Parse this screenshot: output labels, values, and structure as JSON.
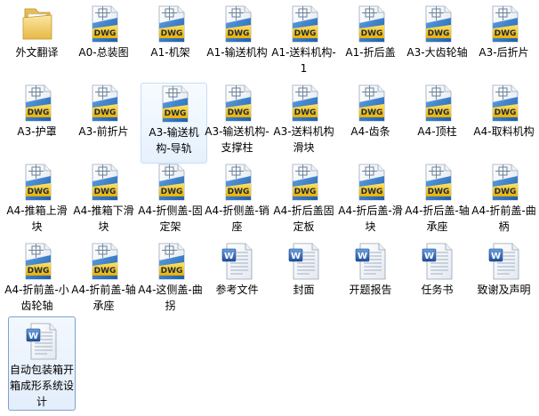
{
  "window": {
    "title": "自动包装箱开箱成形系统设计"
  },
  "icons": {
    "folder": "folder-icon",
    "dwg": "dwg-file-icon",
    "word": "word-document-icon"
  },
  "colors": {
    "selection_border": "#7da2ce",
    "selection_fill": "#e3eefc",
    "dwg_yellow": "#f2c200",
    "dwg_blue": "#2e76c6"
  },
  "files": [
    {
      "name": "外文翻译",
      "type": "folder"
    },
    {
      "name": "A0-总装图",
      "type": "dwg"
    },
    {
      "name": "A1-机架",
      "type": "dwg"
    },
    {
      "name": "A1-输送机构",
      "type": "dwg"
    },
    {
      "name": "A1-送料机构-1",
      "type": "dwg"
    },
    {
      "name": "A1-折后盖",
      "type": "dwg"
    },
    {
      "name": "A3-大齿轮轴",
      "type": "dwg"
    },
    {
      "name": "A3-后折片",
      "type": "dwg"
    },
    {
      "name": "A3-护罩",
      "type": "dwg"
    },
    {
      "name": "A3-前折片",
      "type": "dwg"
    },
    {
      "name": "A3-输送机构-导轨",
      "type": "dwg"
    },
    {
      "name": "A3-输送机构-支撑柱",
      "type": "dwg"
    },
    {
      "name": "A3-送料机构滑块",
      "type": "dwg"
    },
    {
      "name": "A4-齿条",
      "type": "dwg"
    },
    {
      "name": "A4-顶柱",
      "type": "dwg"
    },
    {
      "name": "A4-取料机构",
      "type": "dwg"
    },
    {
      "name": "A4-推箱上滑块",
      "type": "dwg"
    },
    {
      "name": "A4-推箱下滑块",
      "type": "dwg"
    },
    {
      "name": "A4-折侧盖-固定架",
      "type": "dwg"
    },
    {
      "name": "A4-折侧盖-销座",
      "type": "dwg"
    },
    {
      "name": "A4-折后盖固定板",
      "type": "dwg"
    },
    {
      "name": "A4-折后盖-滑块",
      "type": "dwg"
    },
    {
      "name": "A4-折后盖-轴承座",
      "type": "dwg"
    },
    {
      "name": "A4-折前盖-曲柄",
      "type": "dwg"
    },
    {
      "name": "A4-折前盖-小齿轮轴",
      "type": "dwg"
    },
    {
      "name": "A4-折前盖-轴承座",
      "type": "dwg"
    },
    {
      "name": "A4-这侧盖-曲拐",
      "type": "dwg"
    },
    {
      "name": "参考文件",
      "type": "word"
    },
    {
      "name": "封面",
      "type": "word"
    },
    {
      "name": "开题报告",
      "type": "word"
    },
    {
      "name": "任务书",
      "type": "word"
    },
    {
      "name": "致谢及声明",
      "type": "word"
    },
    {
      "name": "自动包装箱开箱成形系统设计",
      "type": "word"
    }
  ]
}
